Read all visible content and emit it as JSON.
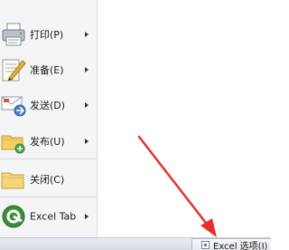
{
  "menu": {
    "items": [
      {
        "name": "print",
        "label": "打印(P)",
        "icon": "printer-icon",
        "has_submenu": true
      },
      {
        "name": "prepare",
        "label": "准备(E)",
        "icon": "prepare-icon",
        "has_submenu": true
      },
      {
        "name": "send",
        "label": "发送(D)",
        "icon": "send-icon",
        "has_submenu": true
      },
      {
        "name": "publish",
        "label": "发布(U)",
        "icon": "publish-icon",
        "has_submenu": true
      },
      {
        "name": "close",
        "label": "关闭(C)",
        "icon": "folder-icon",
        "has_submenu": false
      },
      {
        "name": "excel-tab",
        "label": "Excel Tab",
        "icon": "excel-tab-icon",
        "has_submenu": true
      }
    ]
  },
  "footer": {
    "options_label": "Excel 选项(I)"
  },
  "colors": {
    "annotation_arrow": "#e8302a",
    "menu_background": "#f4f5f7"
  }
}
